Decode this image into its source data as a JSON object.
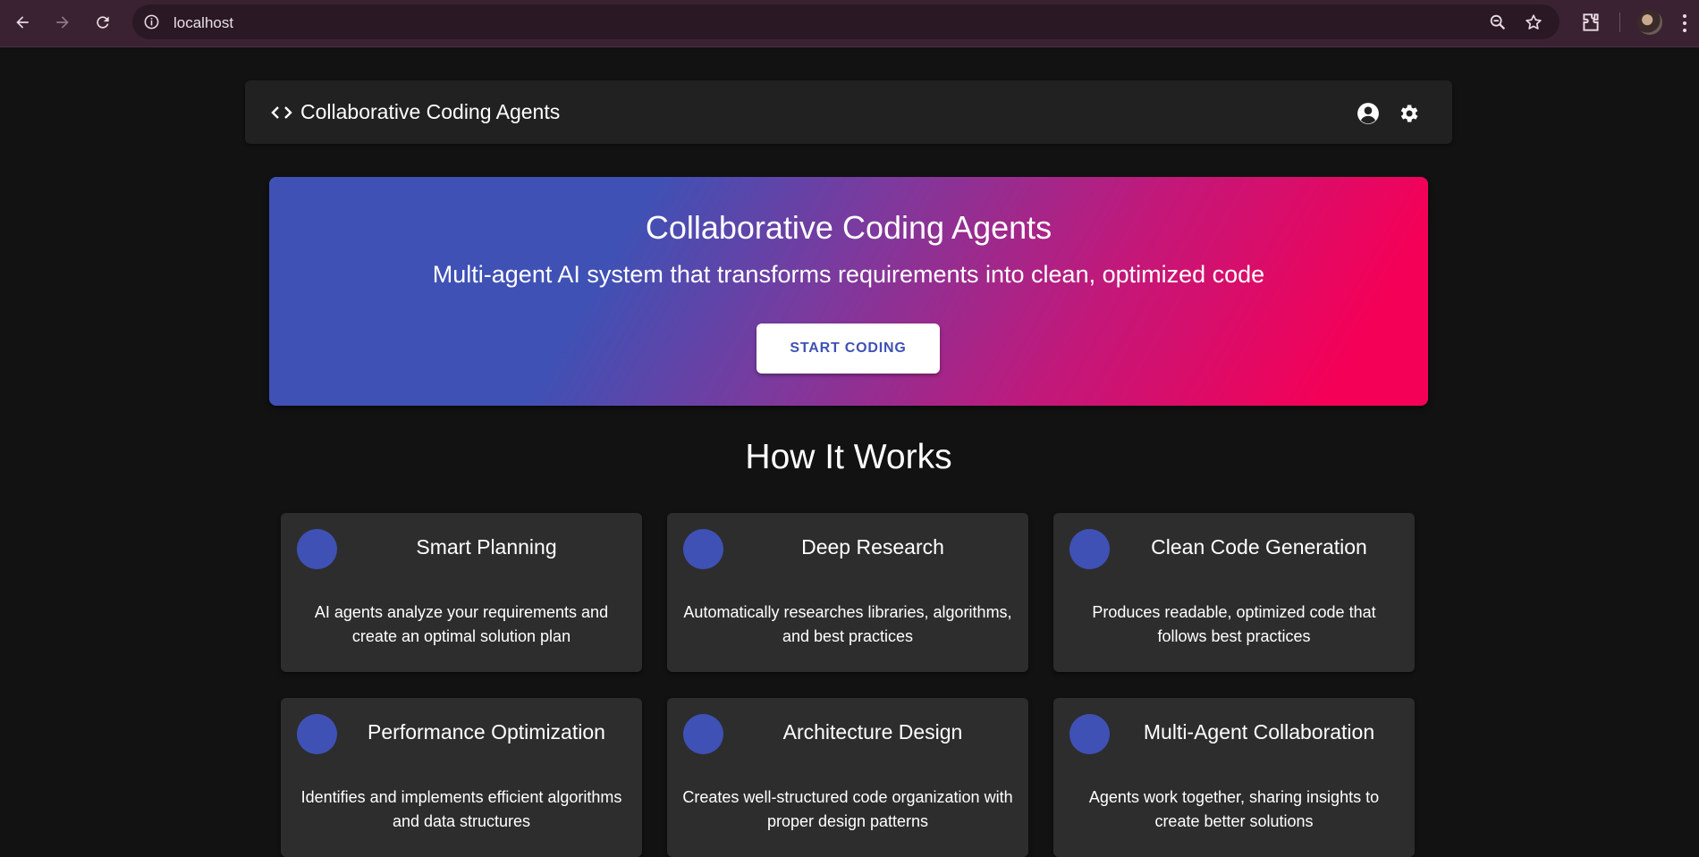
{
  "browser": {
    "url": "localhost"
  },
  "app_bar": {
    "title": "Collaborative Coding Agents"
  },
  "hero": {
    "title": "Collaborative Coding Agents",
    "subtitle": "Multi-agent AI system that transforms requirements into clean, optimized code",
    "button_label": "START CODING"
  },
  "section": {
    "title": "How It Works"
  },
  "features": [
    {
      "title": "Smart Planning",
      "description": "AI agents analyze your requirements and create an optimal solution plan"
    },
    {
      "title": "Deep Research",
      "description": "Automatically researches libraries, algorithms, and best practices"
    },
    {
      "title": "Clean Code Generation",
      "description": "Produces readable, optimized code that follows best practices"
    },
    {
      "title": "Performance Optimization",
      "description": "Identifies and implements efficient algorithms and data structures"
    },
    {
      "title": "Architecture Design",
      "description": "Creates well-structured code organization with proper design patterns"
    },
    {
      "title": "Multi-Agent Collaboration",
      "description": "Agents work together, sharing insights to create better solutions"
    }
  ],
  "colors": {
    "primary": "#3f51b5",
    "secondary": "#f50057",
    "background": "#121212",
    "surface": "#2d2d2d"
  }
}
